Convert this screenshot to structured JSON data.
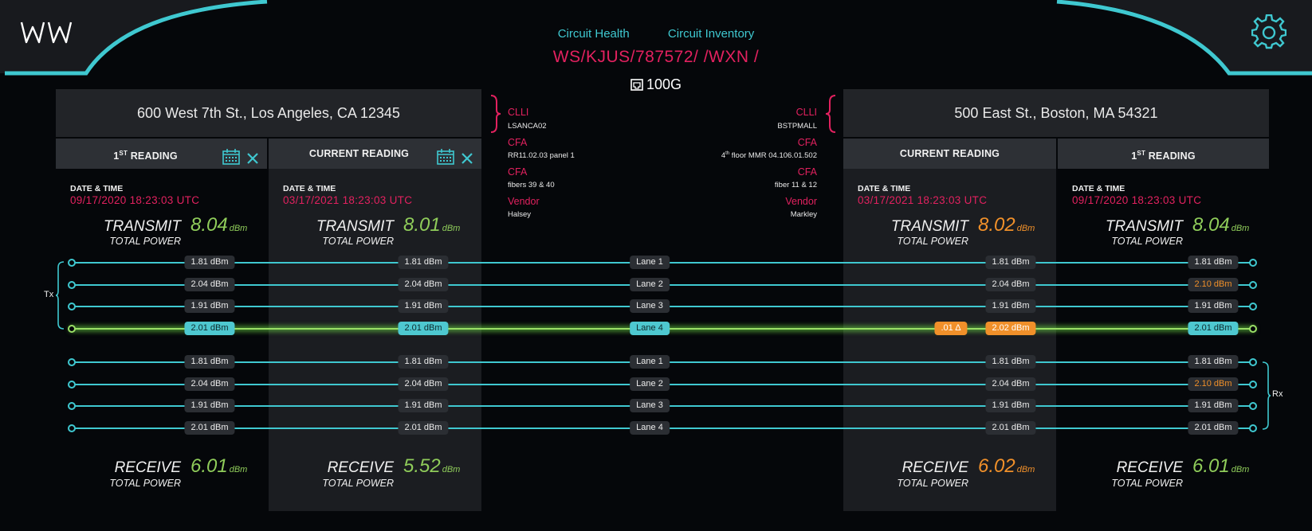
{
  "nav": {
    "circuit_health": "Circuit Health",
    "circuit_inventory": "Circuit Inventory"
  },
  "circuit": {
    "id": "WS/KJUS/787572/ /WXN /",
    "speed": "100G"
  },
  "left_site": {
    "address": "600 West 7th St., Los Angeles, CA 12345"
  },
  "right_site": {
    "address": "500 East St., Boston, MA 54321"
  },
  "center": {
    "left": {
      "clli_label": "CLLI",
      "clli": "LSANCA02",
      "cfa1_label": "CFA",
      "cfa1": "RR11.02.03 panel 1",
      "cfa2_label": "CFA",
      "cfa2": "fibers 39 & 40",
      "vendor_label": "Vendor",
      "vendor": "Halsey"
    },
    "right": {
      "clli_label": "CLLI",
      "clli": "BSTPMALL",
      "cfa1_label": "CFA",
      "cfa1_pre": "4",
      "cfa1_sup": "th",
      "cfa1_post": " floor MMR 04.106.01.502",
      "cfa2_label": "CFA",
      "cfa2": "fiber 11 & 12",
      "vendor_label": "Vendor",
      "vendor": "Markley"
    }
  },
  "labels": {
    "date_time": "DATE & TIME",
    "transmit": "TRANSMIT",
    "receive": "RECEIVE",
    "total_power": "TOTAL POWER",
    "unit": "dBm",
    "tx": "Tx",
    "rx": "Rx"
  },
  "columns": [
    {
      "head_pre": "1",
      "head_sup": "ST",
      "head_post": " READING",
      "datetime": "09/17/2020 18:23:03 UTC",
      "transmit": "8.04",
      "receive": "6.01",
      "tx_color": "#8fcc5a",
      "rx_color": "#8fcc5a"
    },
    {
      "head_pre": "",
      "head_sup": "",
      "head_post": "CURRENT READING",
      "datetime": "03/17/2021 18:23:03 UTC",
      "transmit": "8.01",
      "receive": "5.52",
      "tx_color": "#8fcc5a",
      "rx_color": "#8fcc5a"
    },
    {
      "head_pre": "",
      "head_sup": "",
      "head_post": "CURRENT READING",
      "datetime": "03/17/2021 18:23:03 UTC",
      "transmit": "8.02",
      "receive": "6.02",
      "tx_color": "#f0902a",
      "rx_color": "#f0902a"
    },
    {
      "head_pre": "1",
      "head_sup": "ST",
      "head_post": " READING",
      "datetime": "09/17/2020 18:23:03 UTC",
      "transmit": "8.04",
      "receive": "6.01",
      "tx_color": "#8fcc5a",
      "rx_color": "#8fcc5a"
    }
  ],
  "tx_lanes": [
    {
      "lane": "Lane 1",
      "values": [
        "1.81 dBm",
        "1.81 dBm",
        "1.81 dBm",
        "1.81 dBm"
      ],
      "highlight": false,
      "warn": [
        false,
        false,
        false,
        false
      ],
      "delta": ""
    },
    {
      "lane": "Lane 2",
      "values": [
        "2.04 dBm",
        "2.04 dBm",
        "2.04 dBm",
        "2.10 dBm"
      ],
      "highlight": false,
      "warn": [
        false,
        false,
        false,
        true
      ],
      "delta": ""
    },
    {
      "lane": "Lane 3",
      "values": [
        "1.91 dBm",
        "1.91 dBm",
        "1.91 dBm",
        "1.91 dBm"
      ],
      "highlight": false,
      "warn": [
        false,
        false,
        false,
        false
      ],
      "delta": ""
    },
    {
      "lane": "Lane 4",
      "values": [
        "2.01 dBm",
        "2.01 dBm",
        "2.02 dBm",
        "2.01 dBm"
      ],
      "highlight": true,
      "warn": [
        false,
        false,
        true,
        false
      ],
      "delta": ".01 Δ"
    }
  ],
  "rx_lanes": [
    {
      "lane": "Lane 1",
      "values": [
        "1.81 dBm",
        "1.81 dBm",
        "1.81 dBm",
        "1.81 dBm"
      ],
      "highlight": false,
      "warn": [
        false,
        false,
        false,
        false
      ],
      "delta": ""
    },
    {
      "lane": "Lane 2",
      "values": [
        "2.04 dBm",
        "2.04 dBm",
        "2.04 dBm",
        "2.10 dBm"
      ],
      "highlight": false,
      "warn": [
        false,
        false,
        false,
        true
      ],
      "delta": ""
    },
    {
      "lane": "Lane 3",
      "values": [
        "1.91 dBm",
        "1.91 dBm",
        "1.91 dBm",
        "1.91 dBm"
      ],
      "highlight": false,
      "warn": [
        false,
        false,
        false,
        false
      ],
      "delta": ""
    },
    {
      "lane": "Lane 4",
      "values": [
        "2.01 dBm",
        "2.01 dBm",
        "2.01 dBm",
        "2.01 dBm"
      ],
      "highlight": false,
      "warn": [
        false,
        false,
        false,
        false
      ],
      "delta": ""
    }
  ],
  "colors": {
    "accent": "#3fc8d0",
    "alert": "#e2215f",
    "good": "#8fcc5a",
    "warn": "#f0902a"
  }
}
